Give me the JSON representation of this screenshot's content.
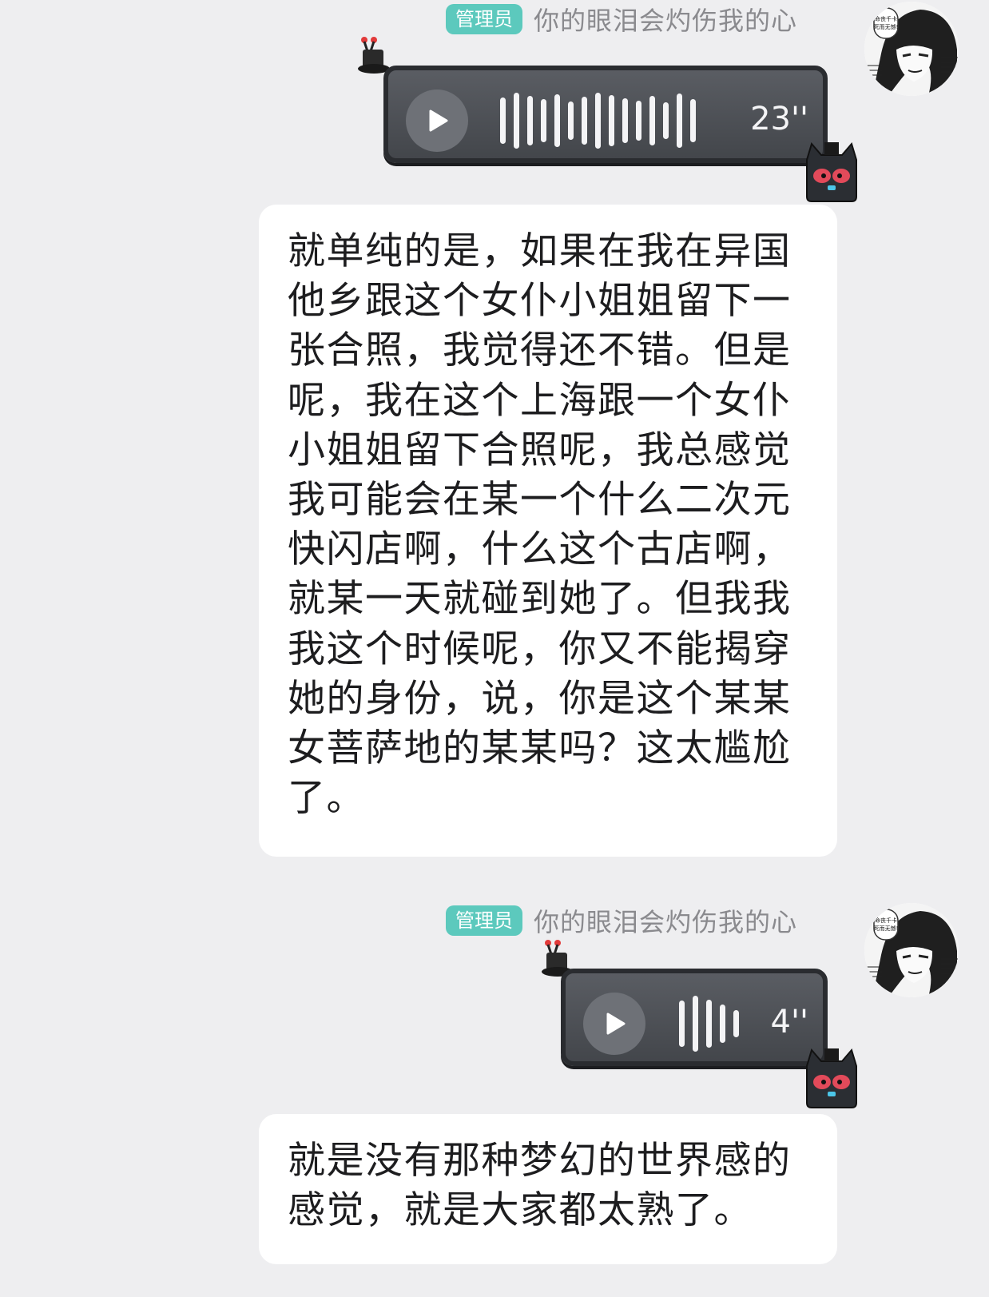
{
  "messages": [
    {
      "role_badge": "管理员",
      "nickname": "你的眼泪会灼伤我的心",
      "avatar_text": "命丧千卡 死而无憾！",
      "voice_duration": "23''",
      "text": "就单纯的是，如果在我在异国他乡跟这个女仆小姐姐留下一张合照，我觉得还不错。但是呢，我在这个上海跟一个女仆小姐姐留下合照呢，我总感觉我可能会在某一个什么二次元快闪店啊，什么这个古店啊，就某一天就碰到她了。但我我我这个时候呢，你又不能揭穿她的身份，说，你是这个某某女菩萨地的某某吗？这太尴尬了。"
    },
    {
      "role_badge": "管理员",
      "nickname": "你的眼泪会灼伤我的心",
      "avatar_text": "命丧千卡 死而无憾！",
      "voice_duration": "4''",
      "text": "就是没有那种梦幻的世界感的感觉，就是大家都太熟了。"
    }
  ],
  "colors": {
    "background": "#eeeef0",
    "badge": "#5cc9bd",
    "nickname": "#8a8a8e",
    "voice_bubble": "#4b4e53",
    "text_bubble": "#ffffff"
  },
  "icons": [
    "play-icon",
    "waveform-icon",
    "hat-sticker-icon",
    "cat-sticker-icon"
  ]
}
